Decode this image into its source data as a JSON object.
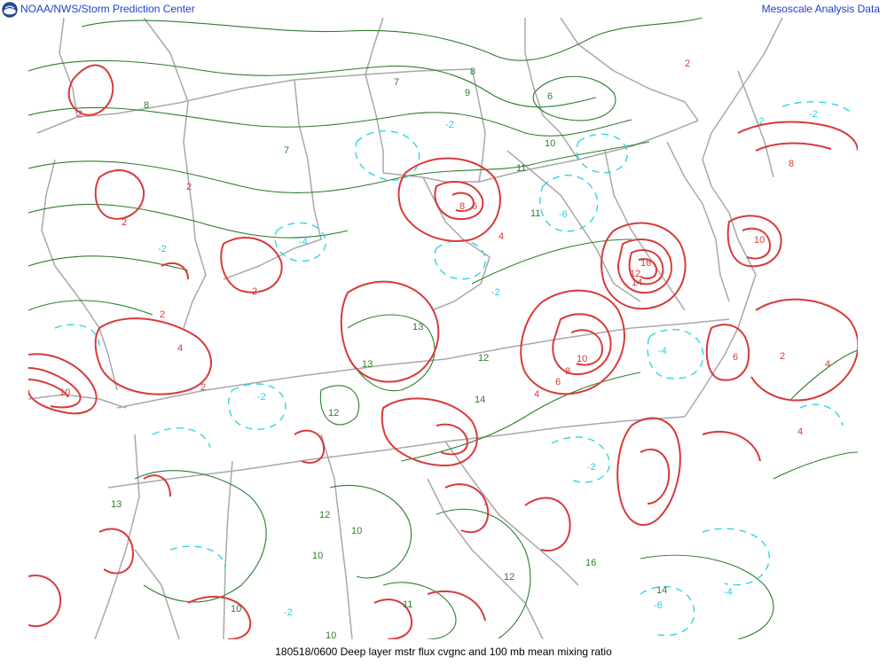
{
  "header": {
    "agency": "NOAA/NWS/Storm Prediction Center",
    "product_group": "Mesoscale Analysis Data"
  },
  "caption": "180518/0600 Deep layer mstr flux cvgnc and 100 mb mean mixing ratio",
  "colors": {
    "header_text": "#1e3fd0",
    "convergence_contour": "#d83a3a",
    "divergence_contour": "#22d3e0",
    "mixing_ratio_contour": "#2e7d2e",
    "boundaries": "#a8a8a8"
  },
  "contour_labels": {
    "mixing_ratio": [
      "6",
      "7",
      "7",
      "8",
      "8",
      "9",
      "10",
      "11",
      "11",
      "12",
      "12",
      "12",
      "12",
      "13",
      "13",
      "13",
      "14",
      "14",
      "10",
      "11",
      "10",
      "10",
      "10",
      "16"
    ],
    "convergence": [
      "2",
      "2",
      "2",
      "2",
      "2",
      "2",
      "2",
      "2",
      "4",
      "4",
      "4",
      "4",
      "4",
      "6",
      "6",
      "6",
      "8",
      "8",
      "8",
      "10",
      "10",
      "10",
      "12",
      "14",
      "16"
    ],
    "divergence": [
      "-2",
      "-2",
      "-2",
      "-2",
      "-2",
      "-4",
      "-4",
      "-4",
      "-6",
      "-6",
      "-2",
      "-2",
      "-2"
    ]
  }
}
